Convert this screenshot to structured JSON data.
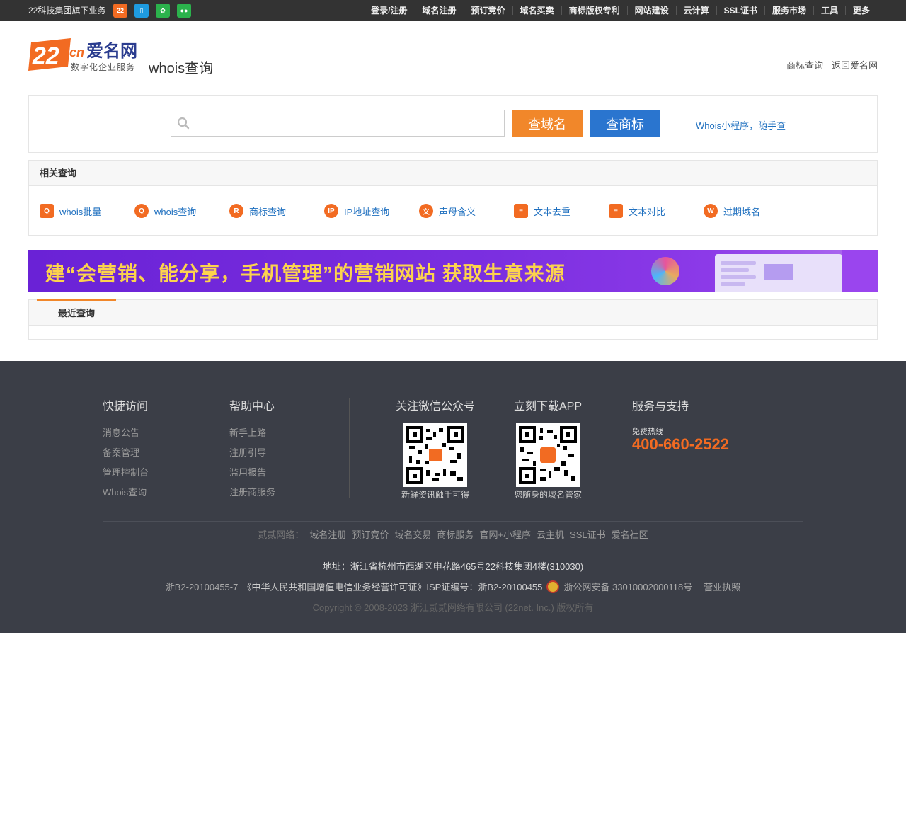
{
  "topbar": {
    "brand": "22科技集团旗下业务",
    "icons": [
      "brand-22-icon",
      "mobile-app-icon",
      "miniprogram-icon",
      "wechat-icon"
    ],
    "nav": [
      "登录/注册",
      "域名注册",
      "预订竞价",
      "域名买卖",
      "商标版权专利",
      "网站建设",
      "云计算",
      "SSL证书",
      "服务市场",
      "工具",
      "更多"
    ]
  },
  "header": {
    "logo_sub": "数字化企业服务",
    "page_title": "whois查询",
    "links": [
      "商标查询",
      "返回爱名网"
    ]
  },
  "search": {
    "placeholder": "",
    "btn_domain": "查域名",
    "btn_trademark": "查商标",
    "mini_link": "Whois小程序，随手查"
  },
  "related": {
    "title": "相关查询",
    "items": [
      {
        "label": "whois批量",
        "glyph": "Q"
      },
      {
        "label": "whois查询",
        "glyph": "Q"
      },
      {
        "label": "商标查询",
        "glyph": "R"
      },
      {
        "label": "IP地址查询",
        "glyph": "IP"
      },
      {
        "label": "声母含义",
        "glyph": "义"
      },
      {
        "label": "文本去重",
        "glyph": "≡"
      },
      {
        "label": "文本对比",
        "glyph": "≡"
      },
      {
        "label": "过期域名",
        "glyph": "W"
      }
    ]
  },
  "banner": {
    "text": "建“会营销、能分享，手机管理”的营销网站  获取生意来源"
  },
  "recent": {
    "title": "最近查询"
  },
  "footer": {
    "quick": {
      "title": "快捷访问",
      "links": [
        "消息公告",
        "备案管理",
        "管理控制台",
        "Whois查询"
      ]
    },
    "help": {
      "title": "帮助中心",
      "links": [
        "新手上路",
        "注册引导",
        "滥用报告",
        "注册商服务"
      ]
    },
    "wechat": {
      "title": "关注微信公众号",
      "caption": "新鲜资讯触手可得"
    },
    "app": {
      "title": "立刻下载APP",
      "caption": "您随身的域名管家"
    },
    "support": {
      "title": "服务与支持",
      "hotline_label": "免费热线",
      "hotline": "400-660-2522"
    },
    "links_label": "贰贰网络：",
    "links": [
      "域名注册",
      "预订竞价",
      "域名交易",
      "商标服务",
      "官网+小程序",
      "云主机",
      "SSL证书",
      "爱名社区"
    ],
    "address": "地址：浙江省杭州市西湖区申花路465号22科技集团4楼(310030)",
    "license_1": "浙B2-20100455-7",
    "license_2": "《中华人民共和国增值电信业务经营许可证》ISP证编号：浙B2-20100455",
    "police": "浙公网安备 33010002000118号",
    "business_license": "营业执照",
    "copyright": "Copyright © 2008-2023 浙江贰贰网络有限公司 (22net. Inc.) 版权所有"
  }
}
